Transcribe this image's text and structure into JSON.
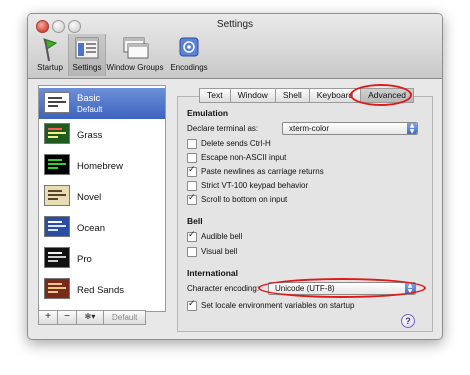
{
  "window": {
    "title": "Settings"
  },
  "toolbar": [
    {
      "label": "Startup"
    },
    {
      "label": "Settings"
    },
    {
      "label": "Window Groups"
    },
    {
      "label": "Encodings"
    }
  ],
  "profiles": [
    {
      "name": "Basic",
      "sub": "Default"
    },
    {
      "name": "Grass"
    },
    {
      "name": "Homebrew"
    },
    {
      "name": "Novel"
    },
    {
      "name": "Ocean"
    },
    {
      "name": "Pro"
    },
    {
      "name": "Red Sands"
    }
  ],
  "sidebar_buttons": {
    "add": "+",
    "remove": "−",
    "gear": "✻▾",
    "default": "Default"
  },
  "tabs": [
    "Text",
    "Window",
    "Shell",
    "Keyboard",
    "Advanced"
  ],
  "emulation": {
    "heading": "Emulation",
    "declare_label": "Declare terminal as:",
    "declare_value": "xterm-color",
    "options": [
      {
        "label": "Delete sends Ctrl-H",
        "checked": false
      },
      {
        "label": "Escape non-ASCII input",
        "checked": false
      },
      {
        "label": "Paste newlines as carriage returns",
        "checked": true
      },
      {
        "label": "Strict VT-100 keypad behavior",
        "checked": false
      },
      {
        "label": "Scroll to bottom on input",
        "checked": true
      }
    ]
  },
  "bell": {
    "heading": "Bell",
    "options": [
      {
        "label": "Audible bell",
        "checked": true
      },
      {
        "label": "Visual bell",
        "checked": false
      }
    ]
  },
  "international": {
    "heading": "International",
    "encoding_label": "Character encoding:",
    "encoding_value": "Unicode (UTF-8)",
    "locale_label": "Set locale environment variables on startup",
    "locale_checked": true
  },
  "help": "?",
  "colors": {
    "selection": "#3d63bd",
    "highlight": "#e01919"
  }
}
